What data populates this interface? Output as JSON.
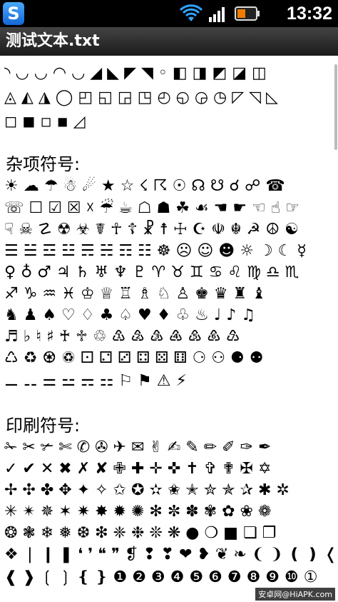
{
  "statusbar": {
    "app_icon_letter": "S",
    "time": "13:32",
    "wifi_icon": "wifi-icon",
    "signal_icon": "signal-icon",
    "battery_icon": "battery-icon"
  },
  "titlebar": {
    "title": "测试文本.txt"
  },
  "sections": {
    "shapes_rows": [
      "◝ ◡ ◡ ◠ ◡ ◢ ◣ ◤ ◥ ◦ ◧ ◨ ◩ ◪ ◫",
      "◬ ◭ ◮ ◯ ◰ ◱ ◲ ◳ ◴ ◵ ◶ ◷ ◸ ◹ ◺",
      "◻ ◼ ◽ ◾ ◿"
    ],
    "misc_heading": "杂项符号:",
    "misc_rows": [
      "☀ ☁ ☂ ☃ ☄ ★ ☆ ☇ ☈ ☉ ☊ ☋ ☌ ☍ ☎",
      "☏ ☐ ☑ ☒ ☓ ☔ ☕ ☖ ☗ ☘ ☙ ☚ ☛ ☜ ☝ ☞",
      "☟ ☠ ☡ ☢ ☣ ☤ ☥ ☦ ☧ ☨ ☩ ☪ ☫ ☬ ☭ ☮ ☯",
      "☰ ☱ ☲ ☳ ☴ ☵ ☶ ☷ ☸ ☹ ☺ ☻ ☼ ☽ ☾ ☿",
      "♀ ♁ ♂ ♃ ♄ ♅ ♆ ♇ ♈ ♉ ♊ ♋ ♌ ♍ ♎ ♏",
      "♐ ♑ ♒ ♓ ♔ ♕ ♖ ♗ ♘ ♙ ♚ ♛ ♜ ♝",
      "♞ ♟ ♠ ♡ ♢ ♣ ♤ ♥ ♦ ♧ ♨ ♩ ♪ ♫",
      "♬ ♭ ♮ ♯ ♰ ♱ ♲ ♳ ♴ ♵ ♶ ♷ ♸ ♹",
      "♺ ♻ ♼ ♽ ⚀ ⚁ ⚂ ⚃ ⚄ ⚅ ⚆ ⚇ ⚈ ⚉",
      "⚊ ⚋ ⚌ ⚍ ⚎ ⚏ ⚐ ⚑ ⚠ ⚡"
    ],
    "print_heading": "印刷符号:",
    "print_rows": [
      "✁ ✂ ✃ ✄ ✆ ✇ ✈ ✉ ✌ ✍ ✎ ✏ ✐ ✑ ✒",
      "✓ ✔ ✕ ✖ ✗ ✘ ✙ ✚ ✛ ✜ ✝ ✞ ✟ ✠ ✡",
      "✢ ✣ ✤ ✥ ✦ ✧ ✩ ✪ ✫ ✬ ✭ ✮ ✯ ✰ ✱ ✲",
      "✳ ✴ ✵ ✶ ✷ ✸ ✹ ✺ ✻ ✼ ✽ ✾ ✿ ❀ ❁",
      "❂ ❃ ❄ ❅ ❆ ❇ ❈ ❉ ❊ ❋ ● ❍ ■ ❏ ❐",
      "❖ ❘ ❙ ❚ ❛ ❜ ❝ ❞ ❡ ❢ ❣ ❤ ❥ ❦ ❧ ❨ ❩ ❪ ❫ ❬ ❭",
      "❰ ❱ ❲ ❳ ❴ ❵ ❶ ❷ ❸ ❹ ❺ ❻ ❼ ❽ ❾ ❿ ①"
    ]
  },
  "watermark": "安卓网@HiAPK.com"
}
